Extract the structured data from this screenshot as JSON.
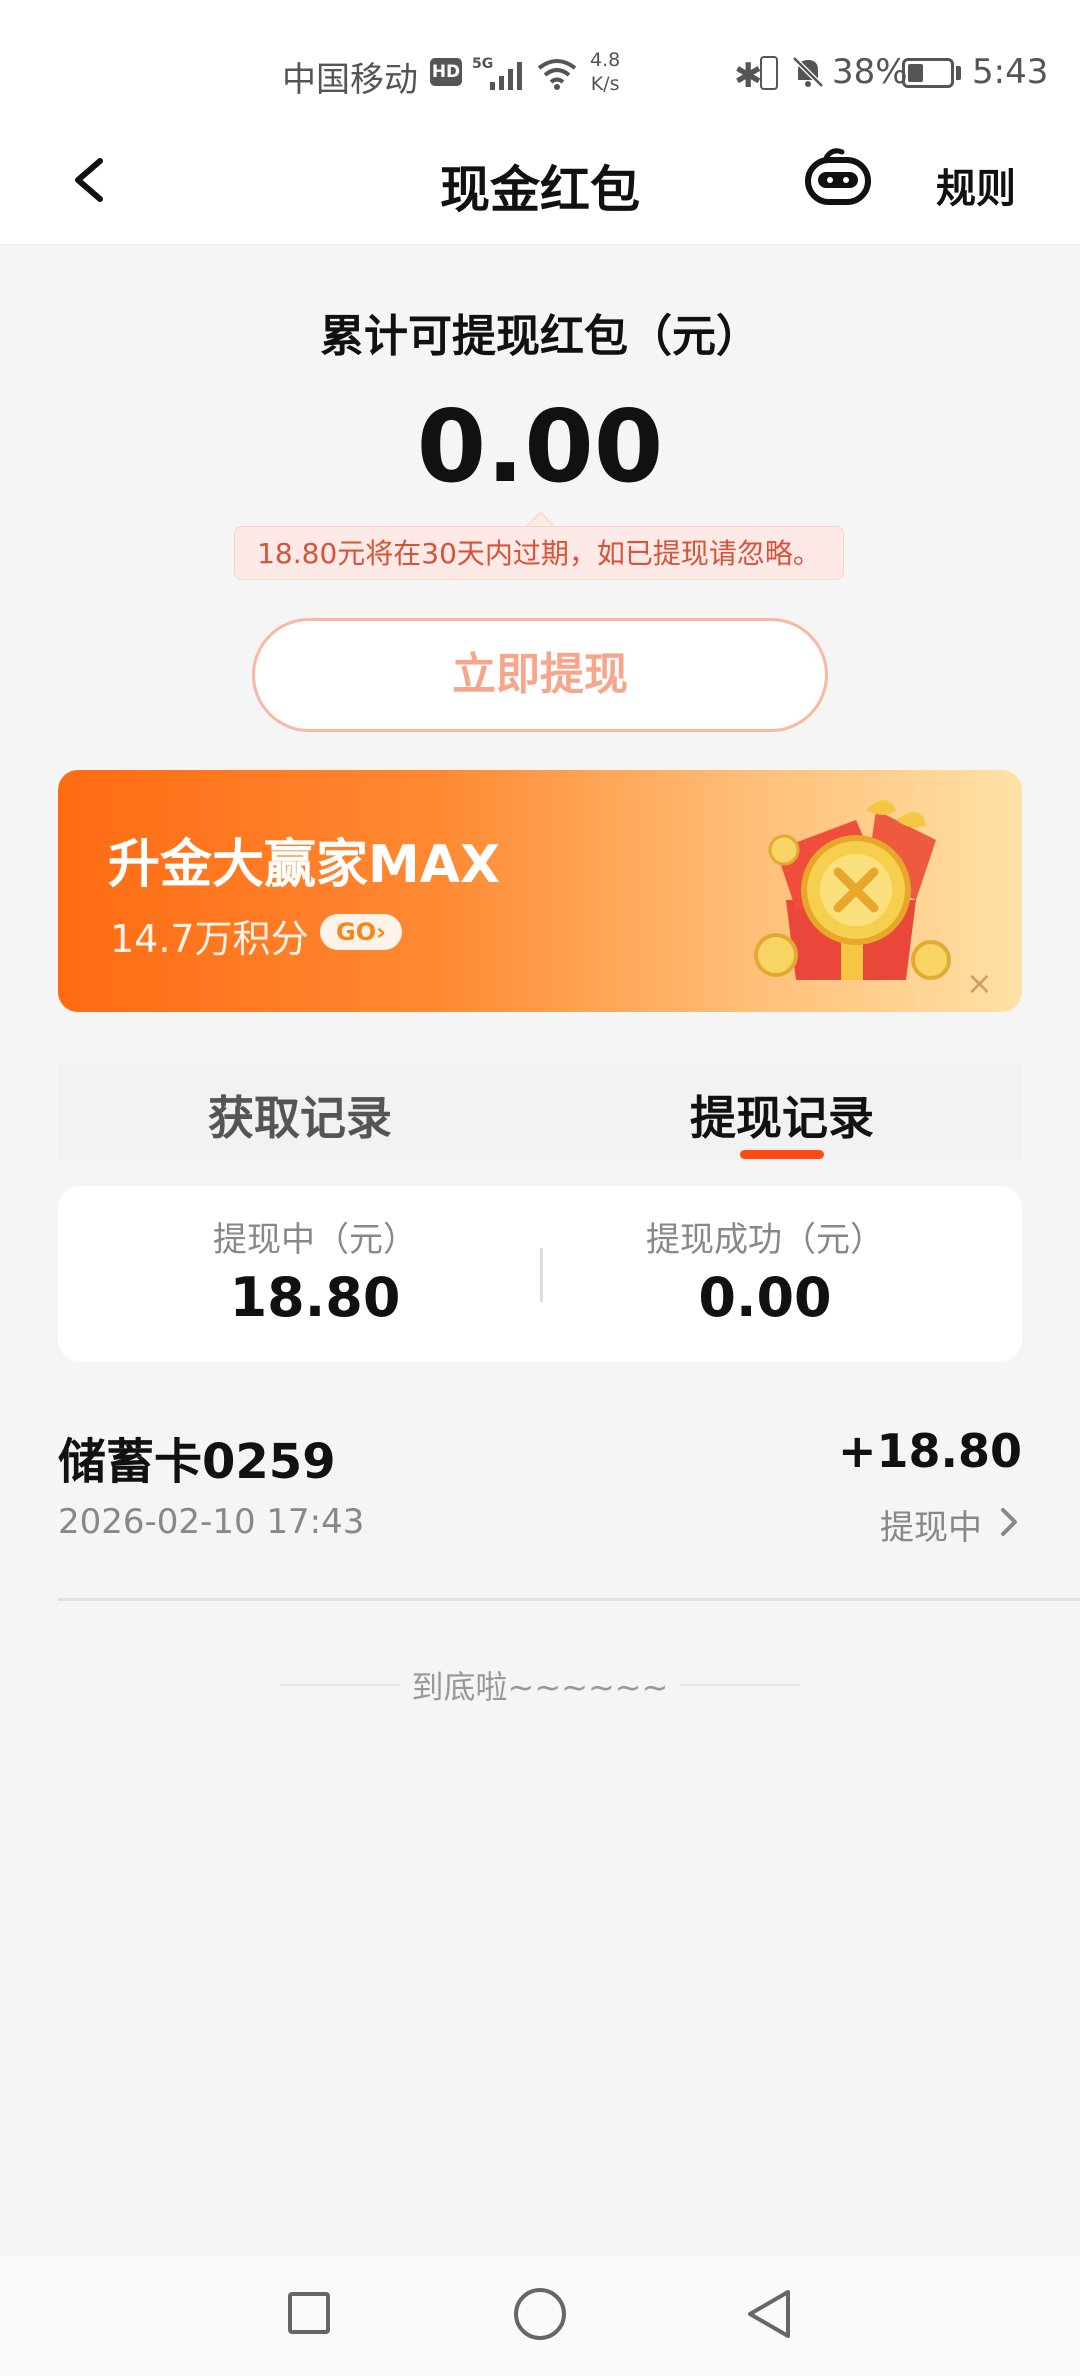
{
  "status_bar": {
    "carrier": "中国移动",
    "hd": "HD",
    "network": "5G",
    "speed_value": "4.8",
    "speed_unit": "K/s",
    "battery_pct": "38%",
    "time": "5:43",
    "battery_level": 0.38
  },
  "header": {
    "title": "现金红包",
    "rules": "规则"
  },
  "balance": {
    "label": "累计可提现红包（元）",
    "amount": "0.00",
    "notice": "18.80元将在30天内过期，如已提现请忽略。",
    "withdraw_button": "立即提现"
  },
  "banner": {
    "title": "升金大赢家MAX",
    "points": "14.7万积分",
    "go": "GO›",
    "close": "×"
  },
  "tabs": [
    {
      "label": "获取记录",
      "active": false
    },
    {
      "label": "提现记录",
      "active": true
    }
  ],
  "summary": {
    "pending_label": "提现中（元）",
    "pending_value": "18.80",
    "success_label": "提现成功（元）",
    "success_value": "0.00"
  },
  "records": [
    {
      "title": "储蓄卡0259",
      "date": "2026-02-10 17:43",
      "amount": "+18.80",
      "status": "提现中"
    }
  ],
  "end_text": "到底啦~~~~~~",
  "colors": {
    "accent": "#ff4a12",
    "banner_start": "#ff6b12",
    "banner_end": "#ffe1a6",
    "notice_text": "#d9523a"
  }
}
